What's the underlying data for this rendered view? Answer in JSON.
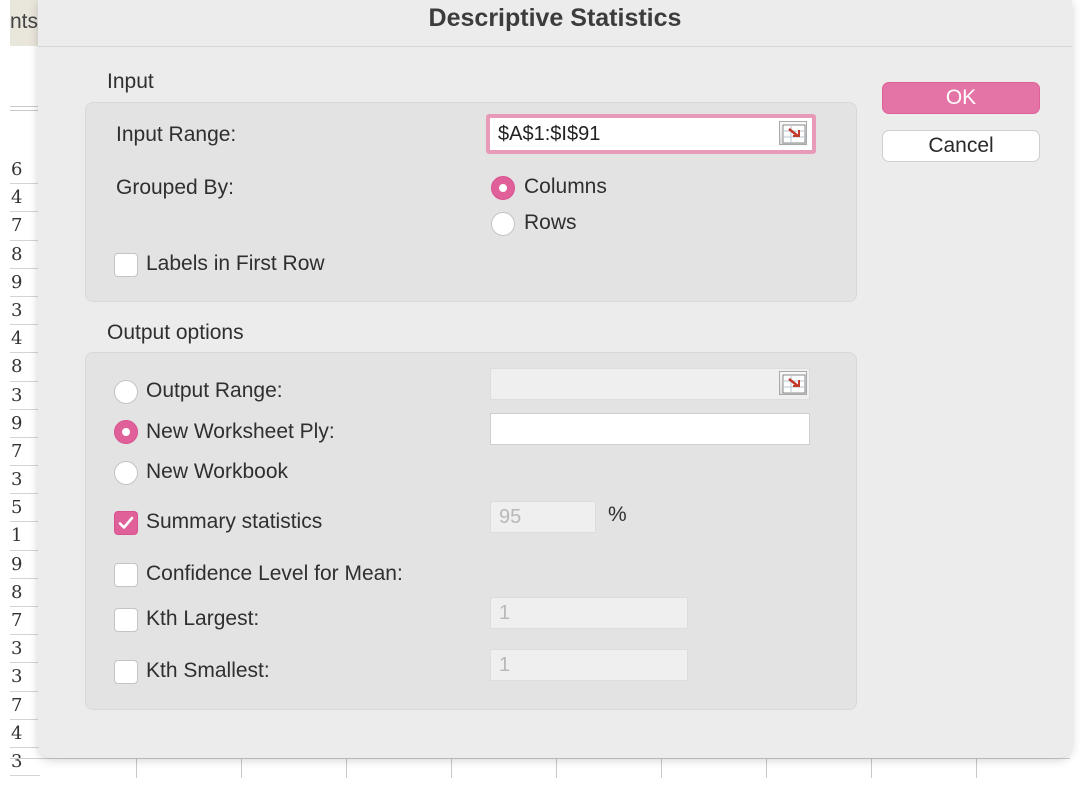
{
  "background": {
    "tab_text": "nts",
    "row_numbers": [
      "6",
      "4",
      "7",
      "8",
      "9",
      "3",
      "4",
      "8",
      "3",
      "9",
      "7",
      "3",
      "5",
      "1",
      "9",
      "8",
      "7",
      "3",
      "3",
      "7",
      "4",
      "3"
    ]
  },
  "dialog": {
    "title": "Descriptive Statistics",
    "buttons": {
      "ok": "OK",
      "cancel": "Cancel"
    },
    "input": {
      "heading": "Input",
      "input_range_label": "Input Range:",
      "input_range_value": "$A$1:$I$91",
      "grouped_by_label": "Grouped By:",
      "columns_label": "Columns",
      "rows_label": "Rows",
      "grouped_by_selected": "Columns",
      "labels_first_row_label": "Labels in First Row",
      "labels_first_row_checked": false
    },
    "output": {
      "heading": "Output options",
      "output_range_label": "Output Range:",
      "output_range_value": "",
      "new_worksheet_label": "New Worksheet Ply:",
      "new_worksheet_value": "",
      "new_workbook_label": "New Workbook",
      "selected": "New Worksheet Ply",
      "summary_label": "Summary statistics",
      "summary_checked": true,
      "confidence_value": "95",
      "percent_sign": "%",
      "confidence_label": "Confidence Level for Mean:",
      "confidence_checked": false,
      "kth_largest_label": "Kth Largest:",
      "kth_largest_value": "1",
      "kth_largest_checked": false,
      "kth_smallest_label": "Kth Smallest:",
      "kth_smallest_value": "1",
      "kth_smallest_checked": false
    }
  },
  "colors": {
    "accent": "#e0609a",
    "ok_button": "#e574a6",
    "focus_ring": "#e89ab9",
    "dialog_bg": "#ececec",
    "group_bg": "#e3e3e3"
  },
  "icons": {
    "range_selector": "range-selector-icon",
    "checkmark": "checkmark-icon"
  }
}
